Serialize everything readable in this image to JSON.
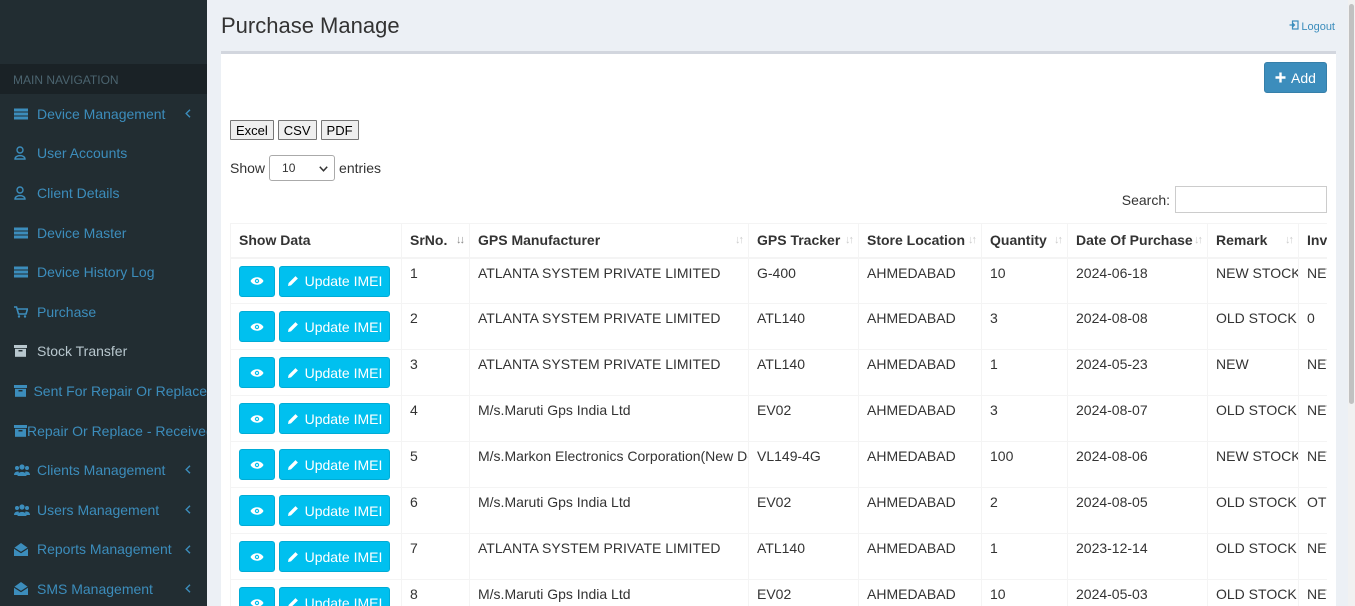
{
  "sidebar": {
    "header": "MAIN NAVIGATION",
    "items": [
      {
        "label": "Device Management",
        "icon": "server-icon",
        "chevron": true
      },
      {
        "label": "User Accounts",
        "icon": "user-icon",
        "chevron": false
      },
      {
        "label": "Client Details",
        "icon": "user-icon",
        "chevron": false
      },
      {
        "label": "Device Master",
        "icon": "server-icon",
        "chevron": false
      },
      {
        "label": "Device History Log",
        "icon": "server-icon",
        "chevron": false
      },
      {
        "label": "Purchase",
        "icon": "cart-icon",
        "chevron": false
      },
      {
        "label": "Stock Transfer",
        "icon": "box-icon",
        "chevron": false,
        "active": true
      },
      {
        "label": "Sent For Repair Or Replace",
        "icon": "box-icon",
        "chevron": false
      },
      {
        "label": "Repair Or Replace - Received",
        "icon": "box-icon",
        "chevron": false
      },
      {
        "label": "Clients Management",
        "icon": "users-icon",
        "chevron": true
      },
      {
        "label": "Users Management",
        "icon": "users-icon",
        "chevron": true
      },
      {
        "label": "Reports Management",
        "icon": "envelope-open-icon",
        "chevron": true
      },
      {
        "label": "SMS Management",
        "icon": "envelope-open-icon",
        "chevron": true
      }
    ]
  },
  "header": {
    "title": "Purchase Manage",
    "logout": "Logout"
  },
  "toolbar": {
    "add_label": "Add",
    "exports": [
      "Excel",
      "CSV",
      "PDF"
    ]
  },
  "length": {
    "show": "Show",
    "value": "10",
    "entries": "entries"
  },
  "search": {
    "label": "Search:",
    "value": ""
  },
  "table": {
    "columns": [
      "Show Data",
      "SrNo.",
      "GPS Manufacturer",
      "GPS Tracker",
      "Store Location",
      "Quantity",
      "Date Of Purchase",
      "Remark",
      "Invoice"
    ],
    "update_label": "Update IMEI",
    "rows": [
      {
        "sr": "1",
        "manufacturer": "ATLANTA SYSTEM PRIVATE LIMITED",
        "tracker": "G-400",
        "location": "AHMEDABAD",
        "qty": "10",
        "date": "2024-06-18",
        "remark": "NEW STOCK",
        "inv": "NEW"
      },
      {
        "sr": "2",
        "manufacturer": "ATLANTA SYSTEM PRIVATE LIMITED",
        "tracker": "ATL140",
        "location": "AHMEDABAD",
        "qty": "3",
        "date": "2024-08-08",
        "remark": "OLD STOCK",
        "inv": "0"
      },
      {
        "sr": "3",
        "manufacturer": "ATLANTA SYSTEM PRIVATE LIMITED",
        "tracker": "ATL140",
        "location": "AHMEDABAD",
        "qty": "1",
        "date": "2024-05-23",
        "remark": "NEW",
        "inv": "NEW"
      },
      {
        "sr": "4",
        "manufacturer": "M/s.Maruti Gps India Ltd",
        "tracker": "EV02",
        "location": "AHMEDABAD",
        "qty": "3",
        "date": "2024-08-07",
        "remark": "OLD STOCK",
        "inv": "NEW"
      },
      {
        "sr": "5",
        "manufacturer": "M/s.Markon Electronics Corporation(New Delh)",
        "tracker": "VL149-4G",
        "location": "AHMEDABAD",
        "qty": "100",
        "date": "2024-08-06",
        "remark": "NEW STOCK",
        "inv": "NEW"
      },
      {
        "sr": "6",
        "manufacturer": "M/s.Maruti Gps India Ltd",
        "tracker": "EV02",
        "location": "AHMEDABAD",
        "qty": "2",
        "date": "2024-08-05",
        "remark": "OLD STOCK",
        "inv": "OTH"
      },
      {
        "sr": "7",
        "manufacturer": "ATLANTA SYSTEM PRIVATE LIMITED",
        "tracker": "ATL140",
        "location": "AHMEDABAD",
        "qty": "1",
        "date": "2023-12-14",
        "remark": "OLD STOCK",
        "inv": "NEW"
      },
      {
        "sr": "8",
        "manufacturer": "M/s.Maruti Gps India Ltd",
        "tracker": "EV02",
        "location": "AHMEDABAD",
        "qty": "10",
        "date": "2024-05-03",
        "remark": "OLD STOCK",
        "inv": "NEW"
      }
    ]
  },
  "colors": {
    "sidebar": "#222d32",
    "link": "#3c8dbc",
    "info": "#00c0ef",
    "primary": "#3c8dbc"
  }
}
